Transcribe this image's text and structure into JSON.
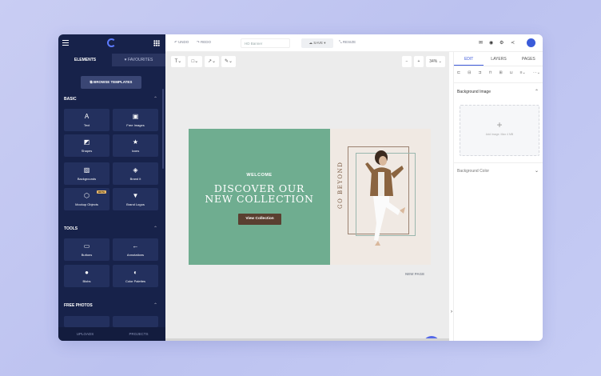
{
  "sidebar": {
    "tabs": [
      "ELEMENTS",
      "FAVOURITES"
    ],
    "browse_label": "BROWSE TEMPLATES",
    "basic_header": "BASIC",
    "basic_items": [
      {
        "label": "Text",
        "icon": "text-icon"
      },
      {
        "label": "Free Images",
        "icon": "image-icon"
      },
      {
        "label": "Shapes",
        "icon": "shapes-icon"
      },
      {
        "label": "Icons",
        "icon": "star-icon"
      },
      {
        "label": "Backgrounds",
        "icon": "backgrounds-icon"
      },
      {
        "label": "Brand it",
        "icon": "tag-icon"
      },
      {
        "label": "Mockup Objects",
        "icon": "cube-icon",
        "badge": "BETA"
      },
      {
        "label": "Brand Logos",
        "icon": "logo-icon"
      }
    ],
    "tools_header": "TOOLS",
    "tools_items": [
      {
        "label": "Buttons",
        "icon": "button-icon"
      },
      {
        "label": "Annotations",
        "icon": "arrow-left-icon"
      },
      {
        "label": "Blobs",
        "icon": "blob-icon"
      },
      {
        "label": "Color Palettes",
        "icon": "palette-icon"
      }
    ],
    "photos_header": "FREE PHOTOS",
    "footer": [
      "UPLOADS",
      "PROJECTS"
    ]
  },
  "topbar": {
    "undo": "UNDO",
    "redo": "REDO",
    "doc_name": "HD Banner",
    "save": "SAVE",
    "resize": "RESIZE"
  },
  "canvas": {
    "zoom": "34%",
    "zoom_minus": "−",
    "zoom_plus": "+",
    "welcome": "WELCOME",
    "headline_1": "DISCOVER OUR",
    "headline_2": "NEW COLLECTION",
    "cta": "View Collection",
    "vertical_text": "GO BEYOND",
    "new_page": "NEW PAGE",
    "help": "?"
  },
  "right_panel": {
    "tabs": [
      "EDIT",
      "LAYERS",
      "PAGES"
    ],
    "bg_image": "Background Image",
    "drop_hint": "Add image. Max 4 MB",
    "bg_color": "Background Color"
  },
  "colors": {
    "sidebar": "#17224a",
    "accent": "#3d5adb",
    "banner_green": "#6fad90",
    "banner_cream": "#f0e9e3",
    "cta_brown": "#5a3f30"
  }
}
